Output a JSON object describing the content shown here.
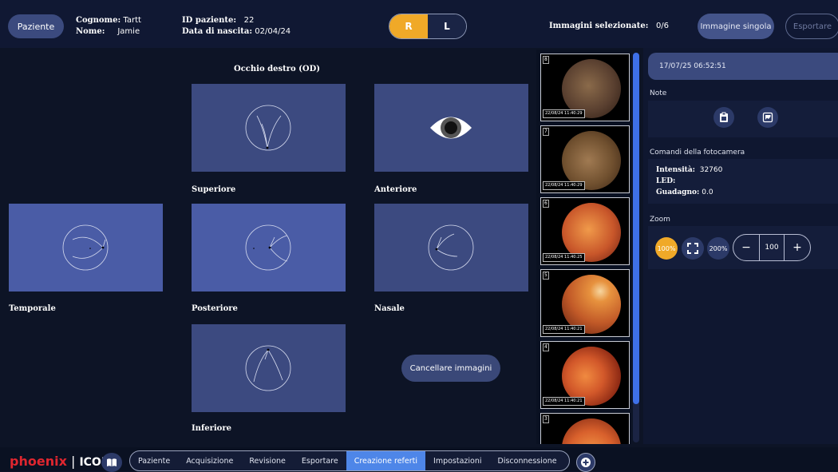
{
  "header": {
    "patient_button": "Paziente",
    "surname_label": "Cognome:",
    "surname_value": "Tartt",
    "name_label": "Nome:",
    "name_value": "Jamie",
    "patient_id_label": "ID paziente:",
    "patient_id_value": "22",
    "birth_label": "Data di nascita:",
    "birth_value": "02/04/24",
    "eye_right": "R",
    "eye_left": "L",
    "selected_label": "Immagini selezionate:",
    "selected_value": "0/6",
    "single_image_button": "Immagine singola",
    "export_button": "Esportare"
  },
  "main": {
    "title": "Occhio destro (OD)",
    "views": {
      "superior": "Superiore",
      "anterior": "Anteriore",
      "temporal": "Temporale",
      "posterior": "Posteriore",
      "nasal": "Nasale",
      "inferior": "Inferiore"
    },
    "delete_button": "Cancellare immagini"
  },
  "thumbnails": [
    {
      "index": "8",
      "timestamp": "22/08/24 11:40:29"
    },
    {
      "index": "7",
      "timestamp": "22/08/24 11:40:29"
    },
    {
      "index": "6",
      "timestamp": "22/08/24 11:40:25"
    },
    {
      "index": "5",
      "timestamp": "22/08/24 11:40:21"
    },
    {
      "index": "4",
      "timestamp": "22/08/24 11:40:21"
    },
    {
      "index": "3",
      "timestamp": ""
    }
  ],
  "right_panel": {
    "datetime": "17/07/25 06:52:51",
    "notes_label": "Note",
    "camera_label": "Comandi della fotocamera",
    "intensity_label": "Intensità:",
    "intensity_value": "32760",
    "led_label": "LED:",
    "gain_label": "Guadagno:",
    "gain_value": "0.0",
    "zoom_label": "Zoom",
    "zoom_100": "100%",
    "zoom_200": "200%",
    "zoom_minus": "−",
    "zoom_value": "100",
    "zoom_plus": "+"
  },
  "bottom": {
    "logo_brand": "phoenix",
    "logo_product": "ICON",
    "nav": [
      "Paziente",
      "Acquisizione",
      "Revisione",
      "Esportare",
      "Creazione referti",
      "Impostazioni",
      "Disconnessione"
    ],
    "active_tab": "Creazione referti"
  },
  "colors": {
    "accent_orange": "#f0a928",
    "active_blue": "#4e86e8",
    "view_bg": "#3c4a80"
  }
}
